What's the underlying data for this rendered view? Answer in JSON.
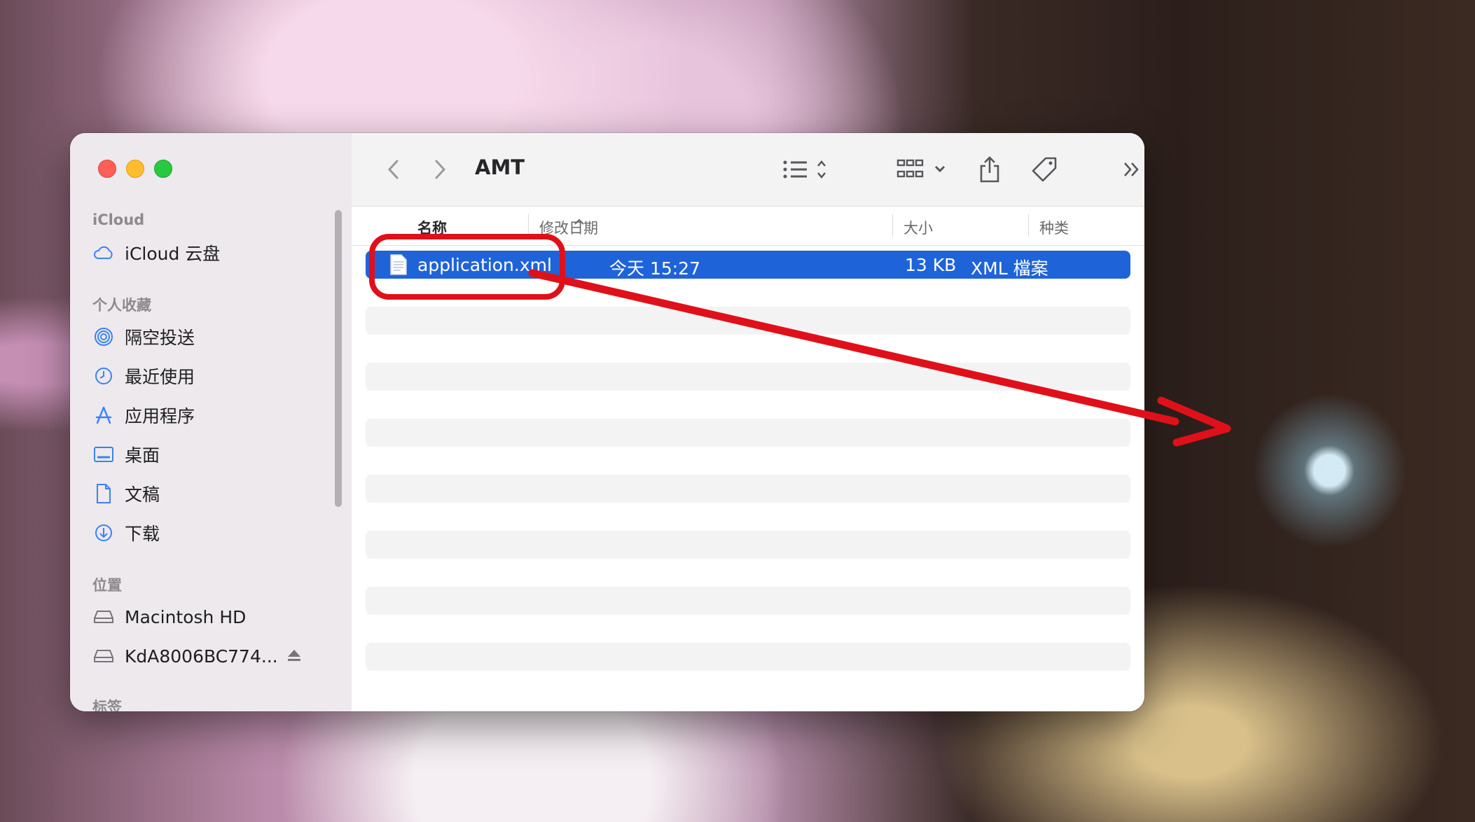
{
  "window": {
    "title": "AMT"
  },
  "sidebar": {
    "sections": [
      {
        "heading": "iCloud",
        "items": [
          {
            "label": "iCloud 云盘",
            "icon": "cloud-icon"
          }
        ]
      },
      {
        "heading": "个人收藏",
        "items": [
          {
            "label": "隔空投送",
            "icon": "airdrop-icon"
          },
          {
            "label": "最近使用",
            "icon": "clock-icon"
          },
          {
            "label": "应用程序",
            "icon": "applications-icon"
          },
          {
            "label": "桌面",
            "icon": "desktop-icon"
          },
          {
            "label": "文稿",
            "icon": "document-icon"
          },
          {
            "label": "下载",
            "icon": "download-icon"
          }
        ]
      },
      {
        "heading": "位置",
        "items": [
          {
            "label": "Macintosh HD",
            "icon": "drive-icon"
          },
          {
            "label": "KdA8006BC774...",
            "icon": "drive-icon",
            "ejectable": true
          }
        ]
      },
      {
        "heading": "标签",
        "items": []
      }
    ]
  },
  "toolbar": {
    "back": "back-icon",
    "forward": "forward-icon",
    "list_view": "list-view-icon",
    "grid_view": "grid-view-icon",
    "share": "share-icon",
    "tag": "tag-icon",
    "more": "more-icon",
    "search": "search-icon"
  },
  "columns": {
    "name": "名称",
    "modified": "修改日期",
    "size": "大小",
    "kind": "种类",
    "sort_indicator": "^"
  },
  "files": [
    {
      "name": "application.xml",
      "modified": "今天 15:27",
      "size": "13 KB",
      "kind": "XML 檔案",
      "selected": true
    }
  ],
  "annotation": {
    "color": "#e0101a",
    "highlight": "application.xml",
    "arrow": "red arrow from the selected file toward the desktop"
  }
}
